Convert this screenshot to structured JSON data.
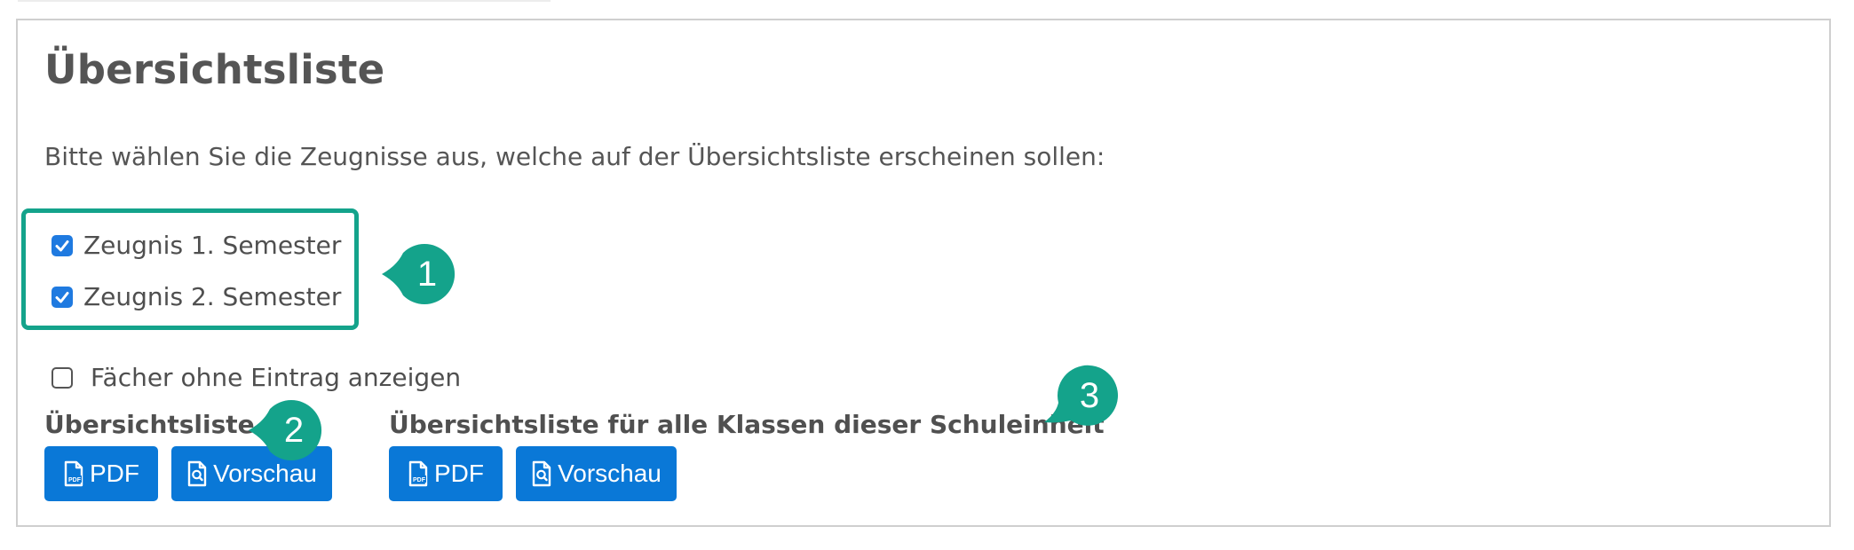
{
  "title": "Übersichtsliste",
  "intro": "Bitte wählen Sie die Zeugnisse aus, welche auf der Übersichtsliste erscheinen sollen:",
  "semester_options": [
    {
      "label": "Zeugnis 1. Semester",
      "checked": true
    },
    {
      "label": "Zeugnis 2. Semester",
      "checked": true
    }
  ],
  "empty_subjects_option": {
    "label": "Fächer ohne Eintrag anzeigen",
    "checked": false
  },
  "overview_section": {
    "label": "Übersichtsliste",
    "pdf_label": "PDF",
    "preview_label": "Vorschau"
  },
  "all_classes_section": {
    "label": "Übersichtsliste für alle Klassen dieser Schuleinheit",
    "pdf_label": "PDF",
    "preview_label": "Vorschau"
  },
  "callouts": [
    "1",
    "2",
    "3"
  ],
  "colors": {
    "accent": "#14a38b",
    "button": "#0a78d7",
    "checkbox": "#1f7ae0"
  },
  "icons": {
    "pdf": "file-pdf-icon",
    "preview": "file-search-icon",
    "check": "checkmark-icon"
  }
}
